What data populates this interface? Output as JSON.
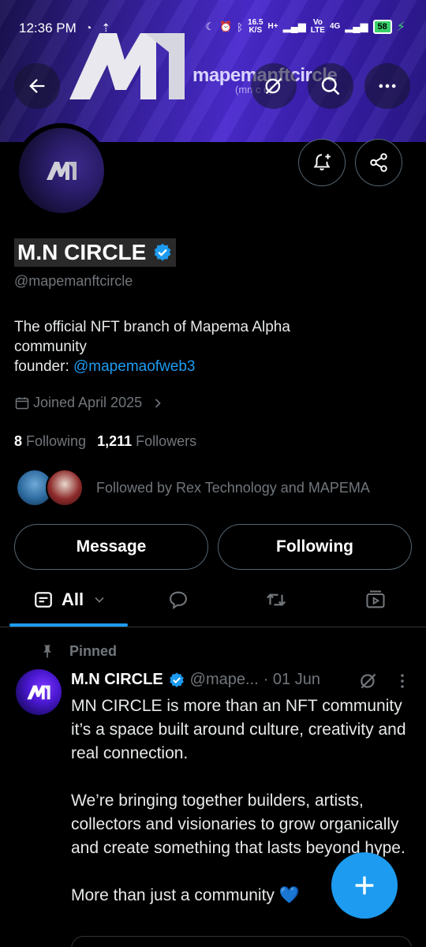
{
  "status_bar": {
    "time": "12:36 PM",
    "net_speed_top": "16.5",
    "net_speed_bottom": "K/S",
    "net_type_1": "H+",
    "net_type_2_top": "Vo",
    "net_type_2_bottom": "LTE",
    "net_type_3": "4G",
    "battery": "58"
  },
  "banner": {
    "brand_text": "mapemanftcircle",
    "brand_sub": "(mn c  e)"
  },
  "profile": {
    "name": "M.N CIRCLE",
    "handle": "@mapemanftcircle",
    "bio_line1": "The official NFT branch of Mapema Alpha",
    "bio_line2": "community",
    "bio_founder_prefix": "founder: ",
    "bio_founder_link": "@mapemaofweb3",
    "joined": "Joined April 2025",
    "following_count": "8",
    "following_label": "Following",
    "followers_count": "1,211",
    "followers_label": "Followers",
    "followed_by": "Followed by Rex Technology and MAPEMA"
  },
  "actions": {
    "message": "Message",
    "following": "Following"
  },
  "tabs": {
    "all": "All"
  },
  "post": {
    "pinned_label": "Pinned",
    "author": "M.N CIRCLE",
    "handle": "@mape...",
    "date": "· 01 Jun",
    "text": "MN CIRCLE is more than an NFT community it’s a space built around culture, creativity and real connection.\n\nWe’re bringing together builders, artists, collectors and visionaries to grow organically and create something that lasts beyond hype.\n\nMore than just a community 💙"
  },
  "colors": {
    "accent": "#1d9bf0",
    "muted": "#71767b",
    "background": "#000000",
    "banner": "#3a22a8"
  },
  "icons": [
    "back-arrow-icon",
    "grok-slash-icon",
    "search-icon",
    "more-horizontal-icon",
    "bell-plus-icon",
    "share-icon",
    "verified-badge-icon",
    "calendar-icon",
    "chevron-right-icon",
    "feed-icon",
    "chevron-down-icon",
    "reply-icon",
    "repost-icon",
    "media-icon",
    "pin-icon",
    "plus-icon"
  ]
}
